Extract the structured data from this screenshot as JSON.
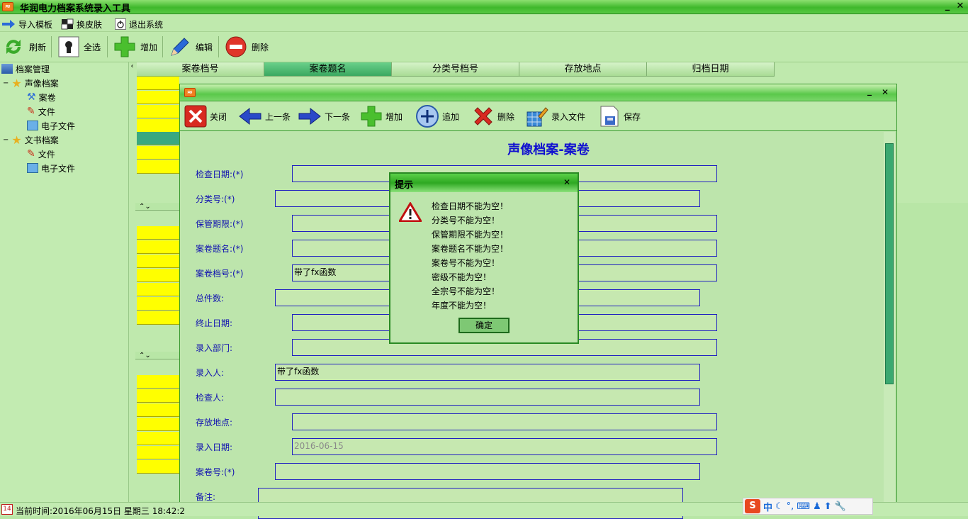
{
  "app": {
    "title": "华润电力档案系统录入工具",
    "minimize": "_",
    "close": "✕"
  },
  "menu": [
    {
      "label": "导入模板",
      "icon": "arrow-right-icon"
    },
    {
      "label": "换皮肤",
      "icon": "skin-icon"
    },
    {
      "label": "退出系统",
      "icon": "power-icon"
    }
  ],
  "toolbar": {
    "refresh": "刷新",
    "select_all": "全选",
    "add": "增加",
    "edit": "编辑",
    "delete": "删除"
  },
  "tree": {
    "root": "档案管理",
    "audio_video": "声像档案",
    "av_case": "案卷",
    "av_file": "文件",
    "av_efile": "电子文件",
    "document": "文书档案",
    "doc_file": "文件",
    "doc_efile": "电子文件"
  },
  "grid": {
    "columns": [
      "案卷档号",
      "案卷题名",
      "分类号档号",
      "存放地点",
      "归档日期"
    ],
    "selected_column": 1,
    "splitter_arrows": "⌃⌄"
  },
  "dialog": {
    "close": "关闭",
    "prev": "上一条",
    "next": "下一条",
    "add": "增加",
    "append": "追加",
    "delete": "删除",
    "import_file": "录入文件",
    "save": "保存",
    "form_title": "声像档案-案卷",
    "fields": {
      "check_date": {
        "label": "检查日期:(*)",
        "value": ""
      },
      "class_no": {
        "label": "分类号:(*)",
        "value": ""
      },
      "retention": {
        "label": "保管期限:(*)",
        "value": ""
      },
      "case_title": {
        "label": "案卷题名:(*)",
        "value": ""
      },
      "case_archive_no": {
        "label": "案卷档号:(*)",
        "value": "带了fx函数"
      },
      "total_pieces": {
        "label": "总件数:",
        "value": ""
      },
      "end_date": {
        "label": "终止日期:",
        "value": ""
      },
      "dept": {
        "label": "录入部门:",
        "value": ""
      },
      "entered_by": {
        "label": "录入人:",
        "value": "带了fx函数"
      },
      "checker": {
        "label": "检查人:",
        "value": ""
      },
      "location": {
        "label": "存放地点:",
        "value": ""
      },
      "entry_date": {
        "label": "录入日期:",
        "value": "2016-06-15"
      },
      "case_no": {
        "label": "案卷号:(*)",
        "value": ""
      },
      "remark": {
        "label": "备注:",
        "value": ""
      }
    }
  },
  "message": {
    "title": "提示",
    "close": "✕",
    "lines": [
      "检查日期不能为空！",
      "分类号不能为空！",
      "保管期限不能为空！",
      "案卷题名不能为空！",
      "案卷号不能为空！",
      "密级不能为空！",
      "全宗号不能为空！",
      "年度不能为空！"
    ],
    "ok": "确定"
  },
  "status": {
    "calendar_day": "14",
    "text": "当前时间:2016年06月15日 星期三 18:42:2"
  },
  "ime": {
    "cn": "中",
    "icons": [
      "moon-icon",
      "punct-icon",
      "keyboard-icon",
      "user-icon",
      "shirt-icon",
      "wrench-icon"
    ]
  }
}
